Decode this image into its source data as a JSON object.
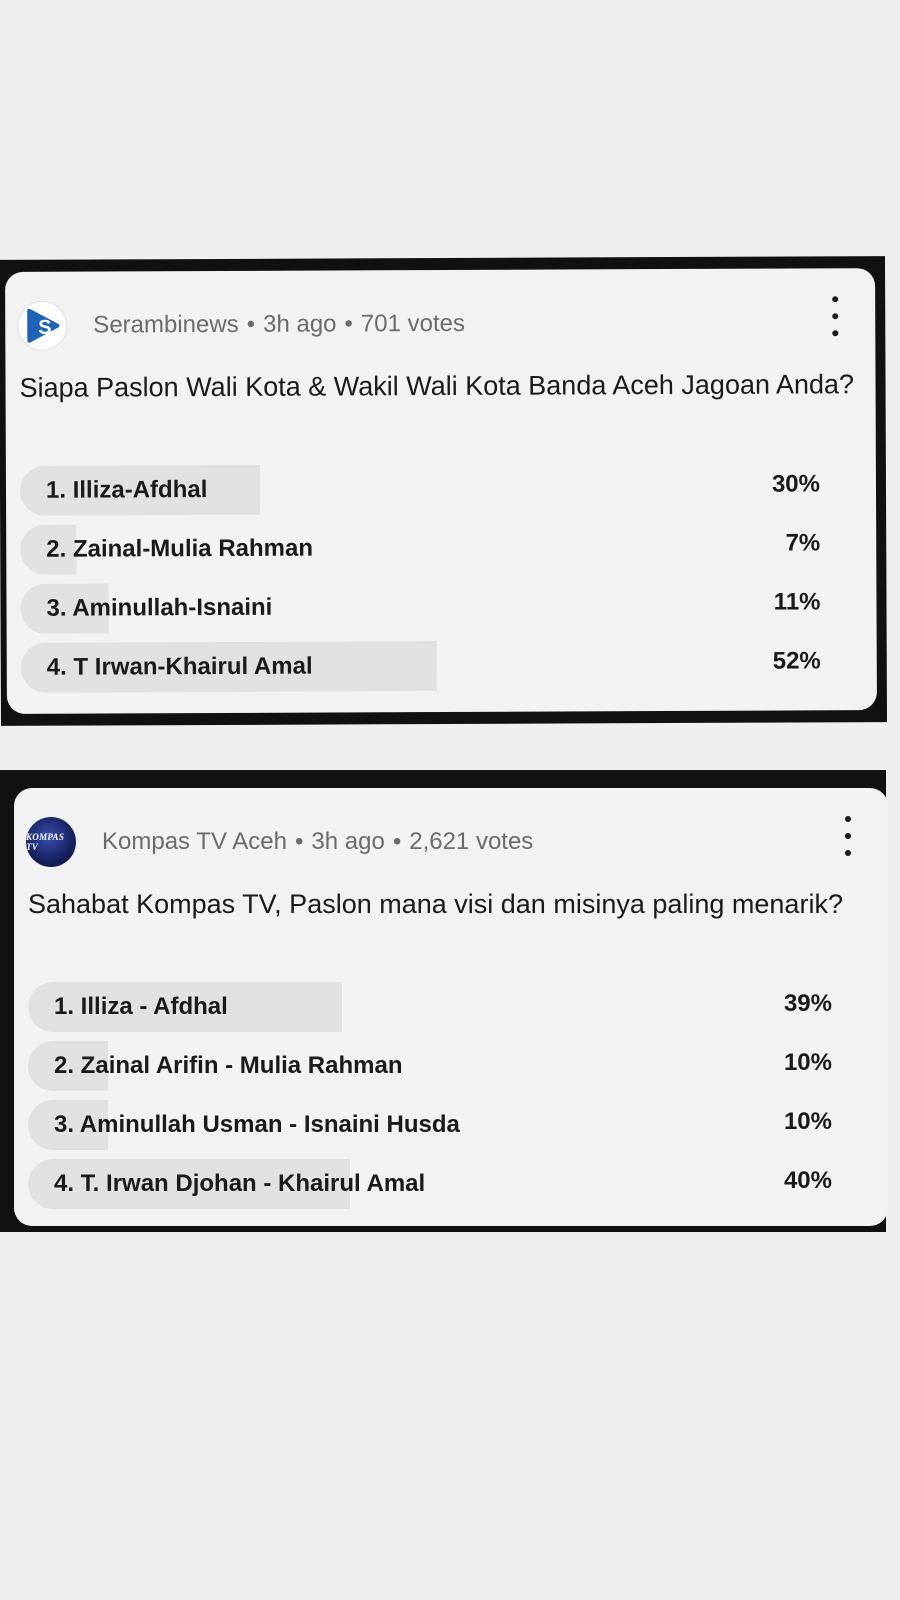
{
  "polls": [
    {
      "channel": "Serambinews",
      "time": "3h ago",
      "votes": "701 votes",
      "question": "Siapa Paslon Wali Kota & Wakil Wali Kota Banda Aceh Jagoan Anda?",
      "avatar_icon": "serambinews-logo",
      "options": [
        {
          "label": "1. Illiza-Afdhal",
          "percent_text": "30%",
          "percent": 30
        },
        {
          "label": "2. Zainal-Mulia Rahman",
          "percent_text": "7%",
          "percent": 7
        },
        {
          "label": "3. Aminullah-Isnaini",
          "percent_text": "11%",
          "percent": 11
        },
        {
          "label": "4. T Irwan-Khairul Amal",
          "percent_text": "52%",
          "percent": 52
        }
      ]
    },
    {
      "channel": "Kompas TV Aceh",
      "time": "3h ago",
      "votes": "2,621 votes",
      "question": "Sahabat Kompas TV, Paslon mana visi dan misinya paling menarik?",
      "avatar_icon": "kompas-tv-logo",
      "avatar_text": "KOMPAS TV",
      "options": [
        {
          "label": "1. Illiza - Afdhal",
          "percent_text": "39%",
          "percent": 39
        },
        {
          "label": "2. Zainal Arifin - Mulia Rahman",
          "percent_text": "10%",
          "percent": 10
        },
        {
          "label": "3. Aminullah Usman - Isnaini Husda",
          "percent_text": "10%",
          "percent": 10
        },
        {
          "label": "4. T. Irwan Djohan - Khairul Amal",
          "percent_text": "40%",
          "percent": 40
        }
      ]
    }
  ],
  "separator": "•",
  "colors": {
    "card_bg": "#f2f2f2",
    "bar_fill": "#e1e1e1",
    "meta_text": "#6b6b6b",
    "brand_serambi": "#1e63b8",
    "brand_kompas": "#16205e"
  }
}
